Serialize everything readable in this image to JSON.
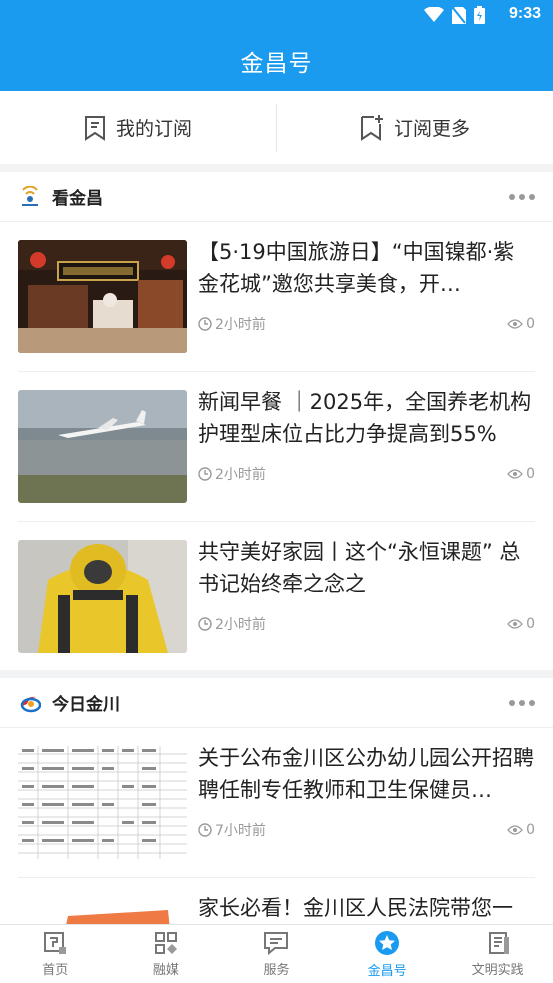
{
  "status": {
    "time": "9:33"
  },
  "header": {
    "title": "金昌号"
  },
  "subbar": {
    "my_subscriptions": "我的订阅",
    "subscribe_more": "订阅更多"
  },
  "sections": [
    {
      "name": "看金昌",
      "items": [
        {
          "title": "【5·19中国旅游日】“中国镍都·紫金花城”邀您共享美食，开…",
          "time": "2小时前",
          "views": "0"
        },
        {
          "title": "新闻早餐 ｜2025年，全国养老机构护理型床位占比力争提高到55%",
          "time": "2小时前",
          "views": "0"
        },
        {
          "title": "共守美好家园丨这个“永恒课题” 总书记始终牵之念之",
          "time": "2小时前",
          "views": "0"
        }
      ]
    },
    {
      "name": "今日金川",
      "items": [
        {
          "title": "关于公布金川区公办幼儿园公开招聘聘任制专任教师和卫生保健员…",
          "time": "7小时前",
          "views": "0"
        },
        {
          "title": "家长必看！金川区人民法院带您一",
          "time": "",
          "views": ""
        }
      ]
    }
  ],
  "tabs": [
    {
      "label": "首页",
      "icon": "home-icon"
    },
    {
      "label": "融媒",
      "icon": "media-grid-icon"
    },
    {
      "label": "服务",
      "icon": "service-chat-icon"
    },
    {
      "label": "金昌号",
      "icon": "star-badge-icon"
    },
    {
      "label": "文明实践",
      "icon": "book-icon"
    }
  ],
  "colors": {
    "brand": "#1a9bef"
  }
}
